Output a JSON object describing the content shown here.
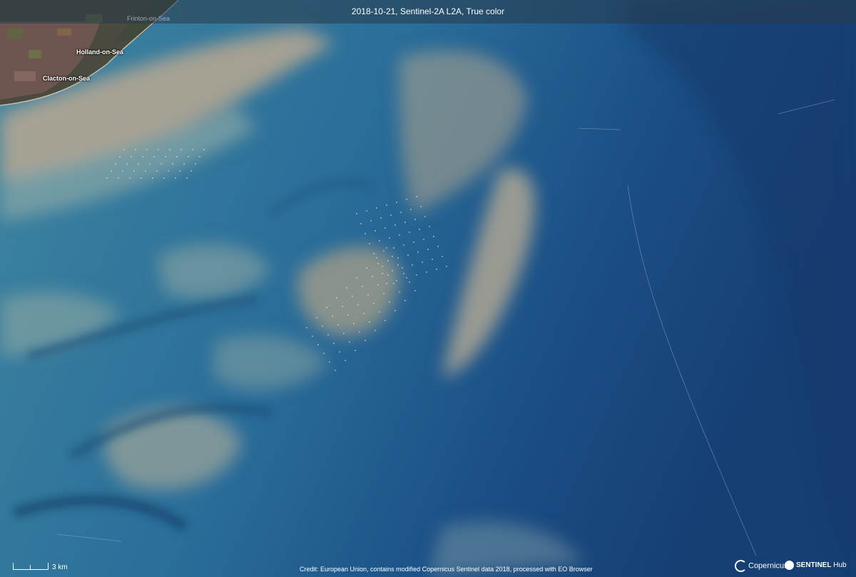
{
  "image": {
    "title": "2018-10-21, Sentinel-2A L2A, True color",
    "places": [
      "Frinton-on-Sea",
      "Holland-on-Sea",
      "Clacton-on-Sea"
    ],
    "scale_label": "3 km",
    "credit": "Credit: European Union, contains modified Copernicus Sentinel data 2018, processed with EO Browser",
    "logos": {
      "copernicus": "Copernicus",
      "sentinel_bold": "SENTINEL",
      "sentinel_rest": " Hub"
    }
  }
}
